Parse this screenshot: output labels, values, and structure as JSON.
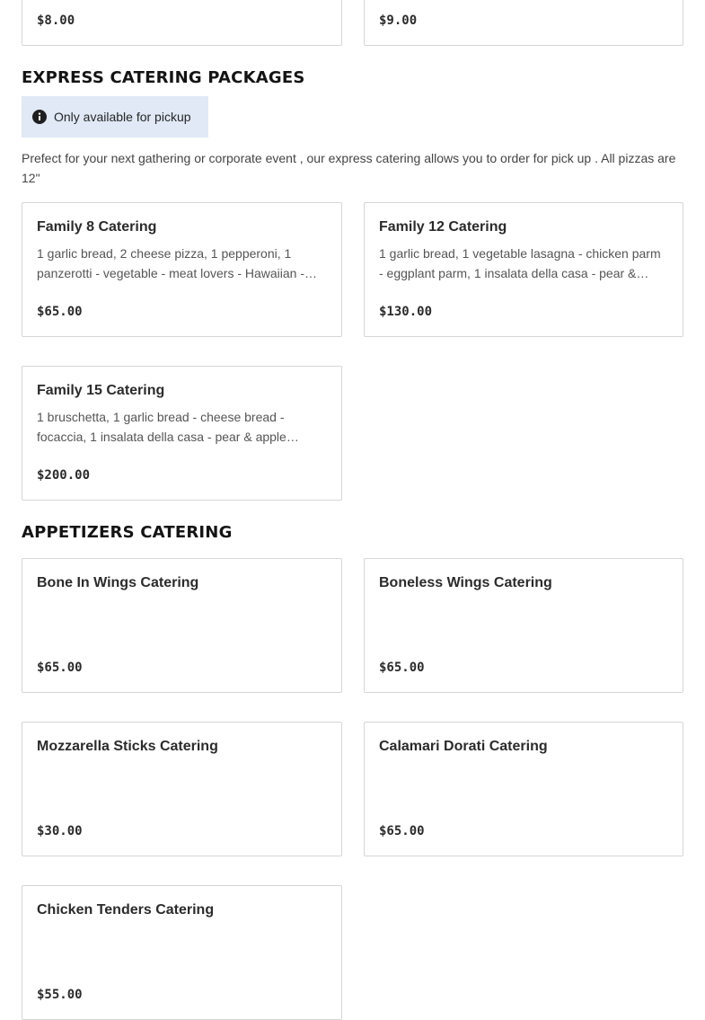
{
  "top_cards": [
    {
      "price": "$8.00"
    },
    {
      "price": "$9.00"
    }
  ],
  "express": {
    "heading": "EXPRESS CATERING PACKAGES",
    "notice": "Only available for pickup",
    "intro": "Prefect for your next gathering or corporate event , our express catering allows you to order for pick up . All pizzas are 12\"",
    "items": [
      {
        "title": "Family 8 Catering",
        "description": "1 garlic bread, 2 cheese pizza, 1 pepperoni, 1 panzerotti - vegetable - meat lovers - Hawaiian -…",
        "price": "$65.00"
      },
      {
        "title": "Family 12 Catering",
        "description": "1 garlic bread, 1 vegetable lasagna - chicken parm - eggplant parm, 1 insalata della casa - pear &…",
        "price": "$130.00"
      },
      {
        "title": "Family 15 Catering",
        "description": "1 bruschetta, 1 garlic bread - cheese bread - focaccia, 1 insalata della casa - pear & apple…",
        "price": "$200.00"
      }
    ]
  },
  "appetizers": {
    "heading": "APPETIZERS CATERING",
    "items": [
      {
        "title": "Bone In Wings Catering",
        "price": "$65.00"
      },
      {
        "title": "Boneless Wings Catering",
        "price": "$65.00"
      },
      {
        "title": "Mozzarella Sticks Catering",
        "price": "$30.00"
      },
      {
        "title": "Calamari Dorati Catering",
        "price": "$65.00"
      },
      {
        "title": "Chicken Tenders Catering",
        "price": "$55.00"
      }
    ]
  },
  "icons": {
    "notice_icon": "info-icon"
  }
}
